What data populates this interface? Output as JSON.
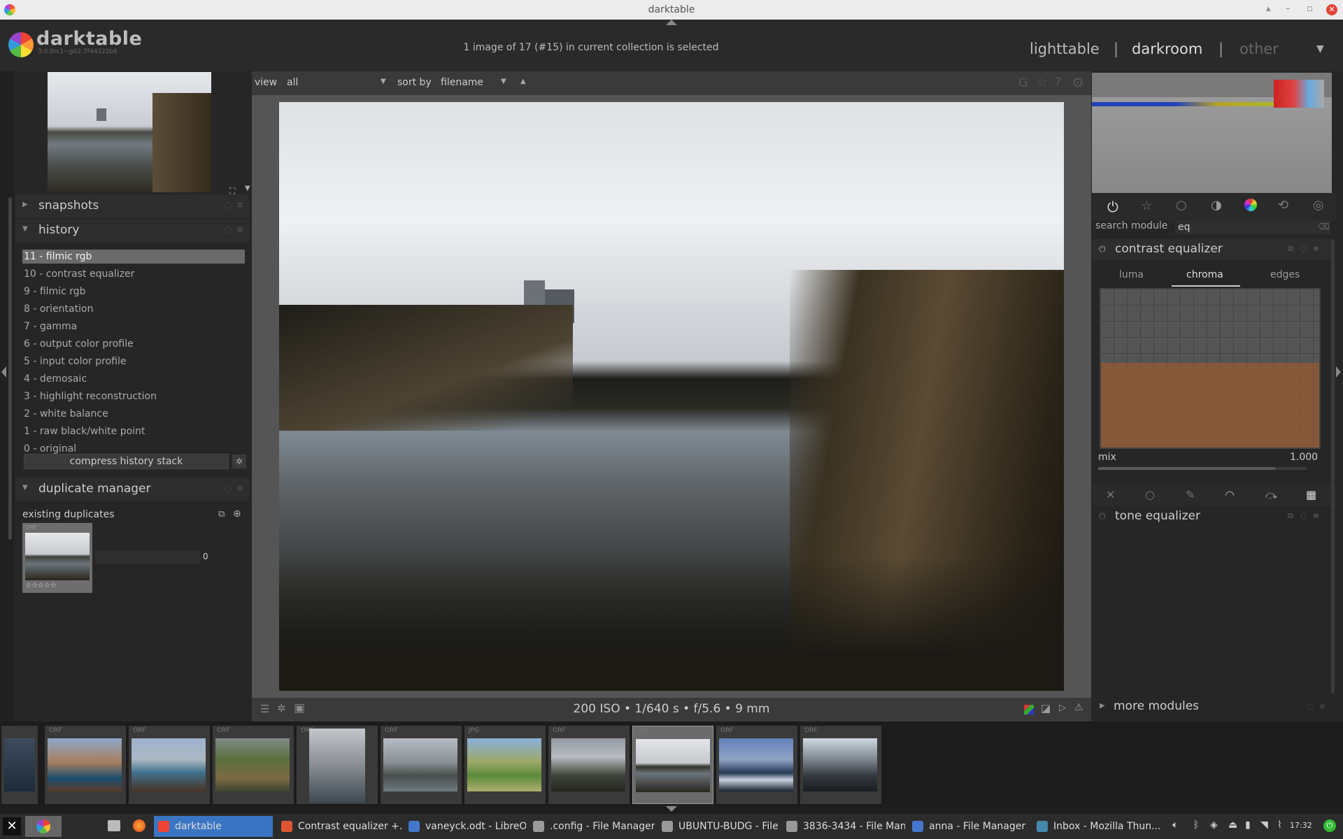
{
  "window": {
    "title": "darktable"
  },
  "app": {
    "name": "darktable",
    "version": "3.0.0rc1~git2.7f44322b6",
    "selection_info": "1 image of 17 (#15) in current collection is selected"
  },
  "views": {
    "lighttable": "lighttable",
    "darkroom": "darkroom",
    "other": "other",
    "sep": "|"
  },
  "left": {
    "snapshots": "snapshots",
    "history": {
      "title": "history",
      "items": [
        "11 - filmic rgb",
        "10 - contrast equalizer",
        "9 - filmic rgb",
        "8 - orientation",
        "7 - gamma",
        "6 - output color profile",
        "5 - input color profile",
        "4 - demosaic",
        "3 - highlight reconstruction",
        "2 - white balance",
        "1 - raw black/white point",
        "0 - original"
      ],
      "compress": "compress history stack"
    },
    "duplicate": {
      "title": "duplicate manager",
      "existing": "existing duplicates",
      "thumb_label": "ORF",
      "count": "0"
    }
  },
  "center": {
    "view_label": "view",
    "view_value": "all",
    "sort_label": "sort by",
    "sort_value": "filename",
    "exif": "200 ISO • 1/640 s • f/5.6 • 9 mm"
  },
  "right": {
    "search_label": "search module",
    "search_value": "eq",
    "module1": "contrast equalizer",
    "tabs": [
      "luma",
      "chroma",
      "edges"
    ],
    "mix_label": "mix",
    "mix_value": "1.000",
    "mix_fraction": 0.85,
    "module2": "tone equalizer",
    "more": "more modules"
  },
  "filmstrip": [
    {
      "t": ""
    },
    {
      "t": "ORF"
    },
    {
      "t": "ORF"
    },
    {
      "t": "ORF"
    },
    {
      "t": "ORF"
    },
    {
      "t": "ORF"
    },
    {
      "t": "JPG"
    },
    {
      "t": "ORF"
    },
    {
      "t": "ORF"
    },
    {
      "t": "ORF"
    },
    {
      "t": "ORF"
    }
  ],
  "taskbar": {
    "items": [
      "darktable",
      "Contrast equalizer +...",
      "vaneyck.odt - LibreO...",
      ".config - File Manager",
      "UBUNTU-BUDG - File...",
      "3836-3434 - File Man...",
      "anna - File Manager",
      "Inbox - Mozilla Thun..."
    ],
    "clock": "17:32"
  }
}
